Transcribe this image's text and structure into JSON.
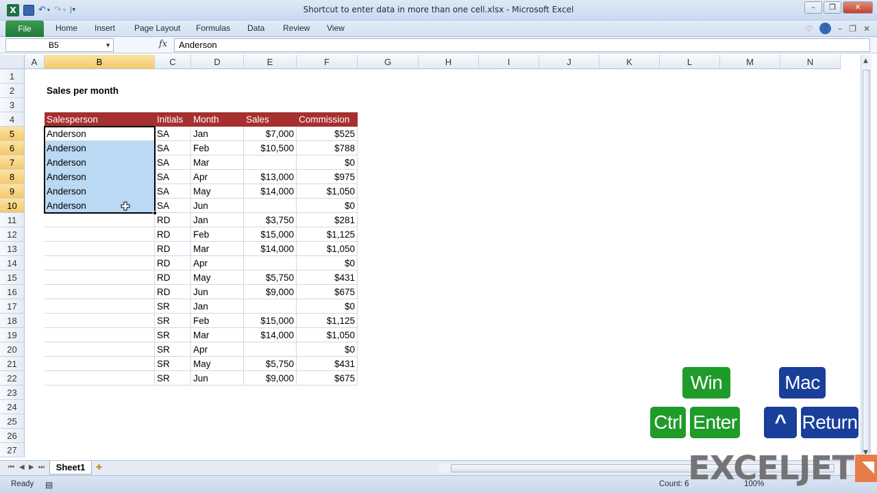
{
  "window": {
    "title": "Shortcut to enter data in more than one cell.xlsx  -  Microsoft Excel"
  },
  "ribbon": {
    "file_label": "File",
    "tabs": [
      "Home",
      "Insert",
      "Page Layout",
      "Formulas",
      "Data",
      "Review",
      "View"
    ]
  },
  "formula_bar": {
    "name_box": "B5",
    "fx_label": "fx",
    "content": "Anderson"
  },
  "columns": [
    "A",
    "B",
    "C",
    "D",
    "E",
    "F",
    "G",
    "H",
    "I",
    "J",
    "K",
    "L",
    "M",
    "N"
  ],
  "rows": [
    "1",
    "2",
    "3",
    "4",
    "5",
    "6",
    "7",
    "8",
    "9",
    "10",
    "11",
    "12",
    "13",
    "14",
    "15",
    "16",
    "17",
    "18",
    "19",
    "20",
    "21",
    "22",
    "23",
    "24",
    "25",
    "26",
    "27"
  ],
  "sheet": {
    "title": "Sales per month",
    "headers": [
      "Salesperson",
      "Initials",
      "Month",
      "Sales",
      "Commission"
    ],
    "data": [
      [
        "Anderson",
        "SA",
        "Jan",
        "$7,000",
        "$525"
      ],
      [
        "Anderson",
        "SA",
        "Feb",
        "$10,500",
        "$788"
      ],
      [
        "Anderson",
        "SA",
        "Mar",
        "",
        "$0"
      ],
      [
        "Anderson",
        "SA",
        "Apr",
        "$13,000",
        "$975"
      ],
      [
        "Anderson",
        "SA",
        "May",
        "$14,000",
        "$1,050"
      ],
      [
        "Anderson",
        "SA",
        "Jun",
        "",
        "$0"
      ],
      [
        "",
        "RD",
        "Jan",
        "$3,750",
        "$281"
      ],
      [
        "",
        "RD",
        "Feb",
        "$15,000",
        "$1,125"
      ],
      [
        "",
        "RD",
        "Mar",
        "$14,000",
        "$1,050"
      ],
      [
        "",
        "RD",
        "Apr",
        "",
        "$0"
      ],
      [
        "",
        "RD",
        "May",
        "$5,750",
        "$431"
      ],
      [
        "",
        "RD",
        "Jun",
        "$9,000",
        "$675"
      ],
      [
        "",
        "SR",
        "Jan",
        "",
        "$0"
      ],
      [
        "",
        "SR",
        "Feb",
        "$15,000",
        "$1,125"
      ],
      [
        "",
        "SR",
        "Mar",
        "$14,000",
        "$1,050"
      ],
      [
        "",
        "SR",
        "Apr",
        "",
        "$0"
      ],
      [
        "",
        "SR",
        "May",
        "$5,750",
        "$431"
      ],
      [
        "",
        "SR",
        "Jun",
        "$9,000",
        "$675"
      ]
    ]
  },
  "sheet_tab": "Sheet1",
  "status": {
    "ready": "Ready",
    "count": "Count: 6",
    "zoom": "100%"
  },
  "shortcut": {
    "win_label": "Win",
    "mac_label": "Mac",
    "win_keys": [
      "Ctrl",
      "Enter"
    ],
    "mac_keys": [
      "^",
      "Return"
    ]
  },
  "brand": {
    "logo_text": "EXCELJET"
  },
  "colors": {
    "header_fill": "#a5302f",
    "selection_fill": "#b9d9f5",
    "win_key": "#1f9b2a",
    "mac_key": "#1a3f9a"
  }
}
